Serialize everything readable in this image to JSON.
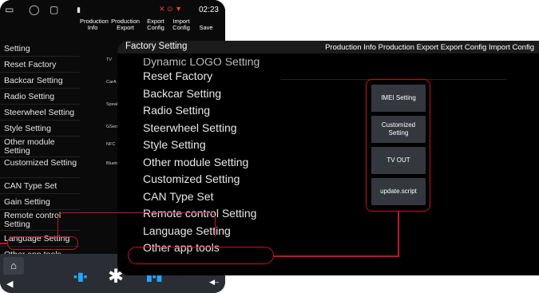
{
  "status": {
    "time": "02:23"
  },
  "phone": {
    "menu": [
      "Production Info",
      "Production Export",
      "Export Config",
      "Import Config",
      "Save"
    ],
    "items": [
      "Setting",
      "Reset Factory",
      "Backcar Setting",
      "Radio Setting",
      "Steerwheel Setting",
      "Style Setting",
      "Other module Setting",
      "Customized Setting",
      "CAN Type Set",
      "Gain Setting",
      "Remote control Setting",
      "Language Setting",
      "Other app tools"
    ],
    "right_labels": [
      "TV",
      "CarA",
      "Speal",
      "GSen",
      "NFC",
      "Blueto"
    ]
  },
  "panel": {
    "title": "Factory Setting",
    "menu": "Production Info Production Export Export Config Import Config",
    "items": [
      "Dynamic LOGO Setting",
      "Reset Factory",
      "Backcar Setting",
      "Radio Setting",
      "Steerwheel Setting",
      "Style Setting",
      "Other module Setting",
      "Customized Setting",
      "CAN Type Set",
      "Remote control Setting",
      "Language Setting",
      "Other app tools"
    ],
    "buttons": [
      "IMEI Setting",
      "Customized Setting",
      "TV OUT",
      "update.script"
    ]
  }
}
